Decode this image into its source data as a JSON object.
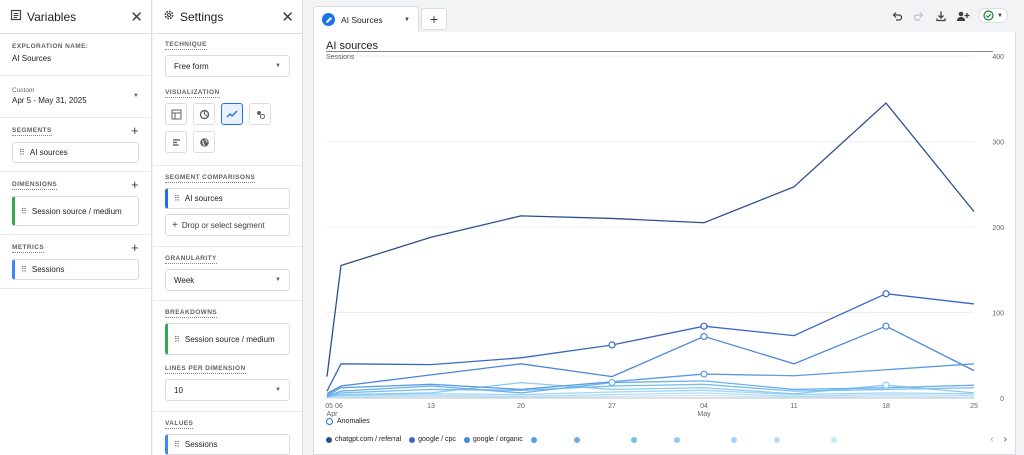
{
  "variables_panel": {
    "title": "Variables",
    "exploration_name_label": "EXPLORATION NAME:",
    "exploration_name": "AI Sources",
    "date_label": "Custom",
    "date_range": "Apr 5 - May 31, 2025",
    "segments_label": "SEGMENTS",
    "segments": [
      "AI sources"
    ],
    "dimensions_label": "DIMENSIONS",
    "dimensions": [
      "Session source / medium"
    ],
    "metrics_label": "METRICS",
    "metrics": [
      "Sessions"
    ]
  },
  "settings_panel": {
    "title": "Settings",
    "technique_label": "TECHNIQUE",
    "technique_value": "Free form",
    "visualization_label": "VISUALIZATION",
    "visualization_icons": [
      "table-icon",
      "donut-icon",
      "line-icon",
      "scatter-icon",
      "bar-icon",
      "geo-icon"
    ],
    "segment_comparisons_label": "SEGMENT COMPARISONS",
    "segment_comparison": "AI sources",
    "drop_segment": "Drop or select segment",
    "granularity_label": "GRANULARITY",
    "granularity_value": "Week",
    "breakdowns_label": "BREAKDOWNS",
    "breakdown": "Session source / medium",
    "lines_per_dimension_label": "LINES PER DIMENSION",
    "lines_per_dimension_value": "10",
    "values_label": "VALUES",
    "value": "Sessions"
  },
  "tab": {
    "label": "AI Sources"
  },
  "toolbar_icons": [
    "undo-icon",
    "redo-icon",
    "download-icon",
    "share-icon",
    "check-circle-icon"
  ],
  "chart": {
    "title": "AI sources",
    "metric_label": "Sessions",
    "anomalies_label": "Anomalies"
  },
  "chart_data": {
    "type": "line",
    "x": [
      "05",
      "06",
      "13",
      "20",
      "27",
      "04",
      "11",
      "18",
      "25"
    ],
    "x_tick_labels": [
      "05 06",
      "13",
      "20",
      "27",
      "04",
      "11",
      "18",
      "25"
    ],
    "x_month_labels": [
      {
        "at": "05",
        "label": "Apr"
      },
      {
        "at": "04",
        "label": "May"
      }
    ],
    "ylim": [
      0,
      400
    ],
    "y_ticks": [
      0,
      100,
      200,
      300,
      400
    ],
    "y_axis_side": "right",
    "grid": true,
    "series": [
      {
        "name": "chatgpt.com / referral",
        "color": "#2b4f8c",
        "values": [
          25,
          155,
          188,
          213,
          210,
          205,
          247,
          345,
          218
        ]
      },
      {
        "name": "google / cpc",
        "color": "#3a67c4",
        "values": [
          8,
          40,
          39,
          47,
          62,
          84,
          73,
          122,
          110
        ],
        "anomalies": [
          "27",
          "04",
          "18"
        ]
      },
      {
        "name": "google / organic",
        "color": "#4a86d8",
        "values": [
          5,
          14,
          27,
          40,
          25,
          72,
          40,
          84,
          32
        ],
        "anomalies": [
          "04",
          "18"
        ]
      },
      {
        "name": "",
        "color": "#5a9be6",
        "values": [
          3,
          12,
          16,
          10,
          19,
          28,
          26,
          33,
          40
        ],
        "anomalies": [
          "04"
        ]
      },
      {
        "name": "",
        "color": "#6aaeea",
        "values": [
          2,
          8,
          14,
          6,
          18,
          20,
          10,
          12,
          15
        ],
        "anomalies": [
          "27"
        ]
      },
      {
        "name": "",
        "color": "#79bdee",
        "values": [
          2,
          6,
          10,
          9,
          14,
          16,
          8,
          10,
          12
        ]
      },
      {
        "name": "",
        "color": "#8ccaf1",
        "values": [
          1,
          4,
          6,
          18,
          10,
          12,
          5,
          15,
          6
        ],
        "anomalies": [
          "18"
        ]
      },
      {
        "name": "",
        "color": "#a3d5f4",
        "values": [
          1,
          3,
          5,
          4,
          7,
          9,
          4,
          6,
          5
        ]
      },
      {
        "name": "",
        "color": "#b8def6",
        "values": [
          1,
          2,
          3,
          2,
          4,
          6,
          2,
          4,
          3
        ]
      },
      {
        "name": "",
        "color": "#cde8f8",
        "values": [
          0,
          1,
          2,
          1,
          2,
          3,
          1,
          2,
          1
        ]
      }
    ],
    "legend": [
      "chatgpt.com / referral",
      "google / cpc",
      "google / organic"
    ],
    "legend_position": "bottom"
  }
}
